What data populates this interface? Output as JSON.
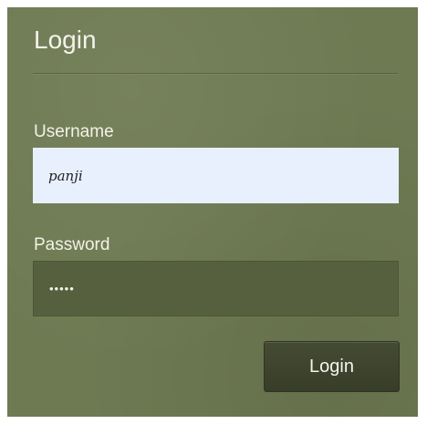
{
  "form": {
    "title": "Login",
    "username_label": "Username",
    "username_value": "panji",
    "password_label": "Password",
    "password_value": "•••••",
    "submit_label": "Login"
  },
  "colors": {
    "panel_background": "#6e7a52",
    "username_field_background": "#e8f0fe",
    "password_field_background": "#56603f",
    "button_background": "#3f4430",
    "text": "#f3f3ec"
  }
}
